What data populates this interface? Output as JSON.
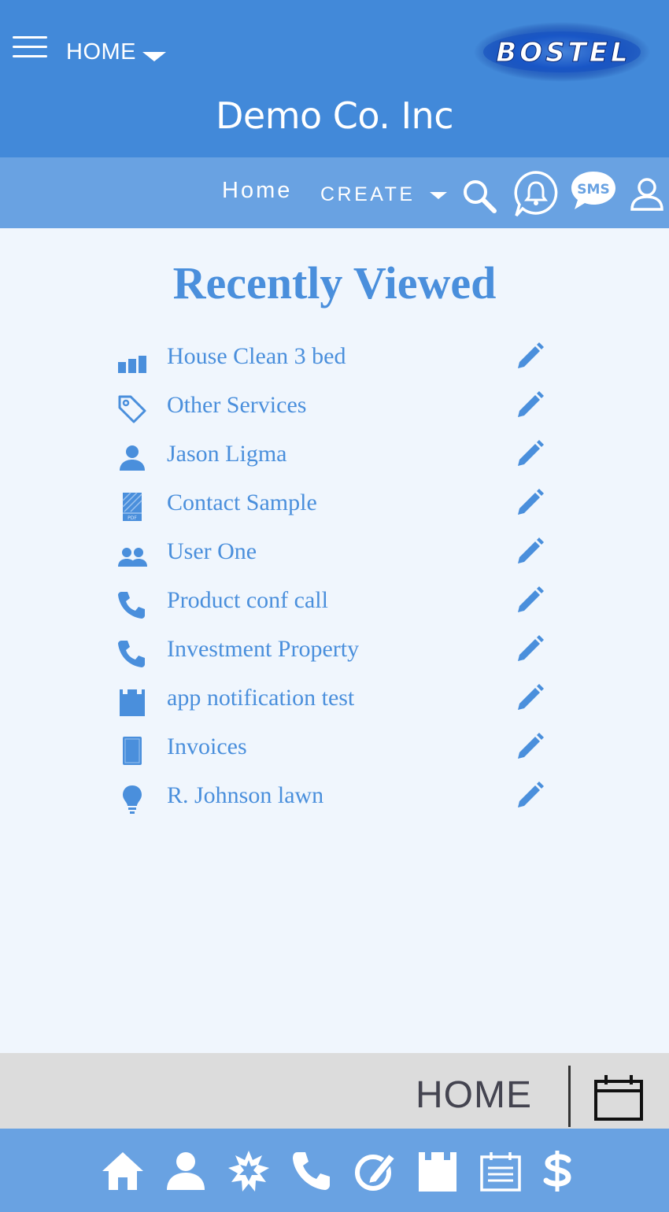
{
  "header": {
    "menu_label": "HOME",
    "logo_text": "BOSTEL",
    "company": "Demo Co. Inc"
  },
  "nav": {
    "home_label": "Home",
    "create_label": "CREATE",
    "sms_badge": "SMS"
  },
  "main": {
    "title": "Recently Viewed",
    "items": [
      {
        "label": "House Clean 3 bed",
        "icon": "bar-chart-icon"
      },
      {
        "label": "Other Services",
        "icon": "tag-icon"
      },
      {
        "label": "Jason Ligma",
        "icon": "person-icon"
      },
      {
        "label": "Contact Sample",
        "icon": "pdf-document-icon"
      },
      {
        "label": "User One",
        "icon": "users-group-icon"
      },
      {
        "label": "Product conf call",
        "icon": "phone-icon"
      },
      {
        "label": "Investment Property",
        "icon": "phone-icon"
      },
      {
        "label": "app notification test",
        "icon": "clapperboard-icon"
      },
      {
        "label": "Invoices",
        "icon": "invoice-icon"
      },
      {
        "label": "R. Johnson lawn",
        "icon": "lightbulb-icon"
      }
    ]
  },
  "footer": {
    "page_label": "HOME"
  },
  "bottom_tabs": [
    "home-icon",
    "person-icon",
    "starburst-icon",
    "phone-icon",
    "edit-circle-icon",
    "clapperboard-icon",
    "notepad-icon",
    "dollar-icon"
  ],
  "colors": {
    "header_bg": "#4289d9",
    "nav_bg": "#69a2e2",
    "accent": "#4a8fdc",
    "page_bg": "#f0f6fd",
    "footer_bg": "#dcdcdc"
  }
}
